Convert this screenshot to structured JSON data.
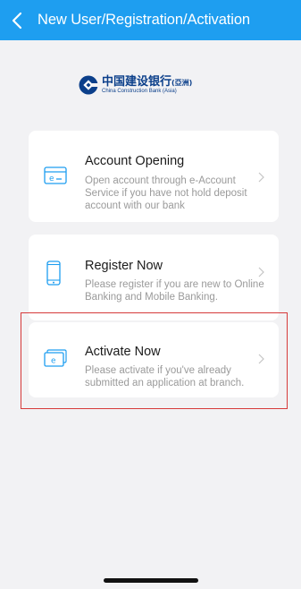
{
  "navbar": {
    "title": "New User/Registration/Activation",
    "back_icon": "chevron-left-icon",
    "color": "#1e9ef0"
  },
  "logo": {
    "chinese_name": "中国建设银行",
    "chinese_suffix": "(亞洲)",
    "english_name": "China Construction Bank (Asia)",
    "brand_color": "#0b3f8a"
  },
  "options": [
    {
      "title": "Account Opening",
      "description": "Open account through e-Account Service if you have not hold deposit account with our bank",
      "icon": "e-account-card-icon"
    },
    {
      "title": "Register Now",
      "description": "Please register if you are new to Online Banking and Mobile Banking.",
      "icon": "mobile-phone-icon"
    },
    {
      "title": "Activate Now",
      "description": "Please activate if you've already submitted an application at branch.",
      "icon": "activation-card-icon"
    }
  ],
  "highlight_color": "#d63a3a"
}
